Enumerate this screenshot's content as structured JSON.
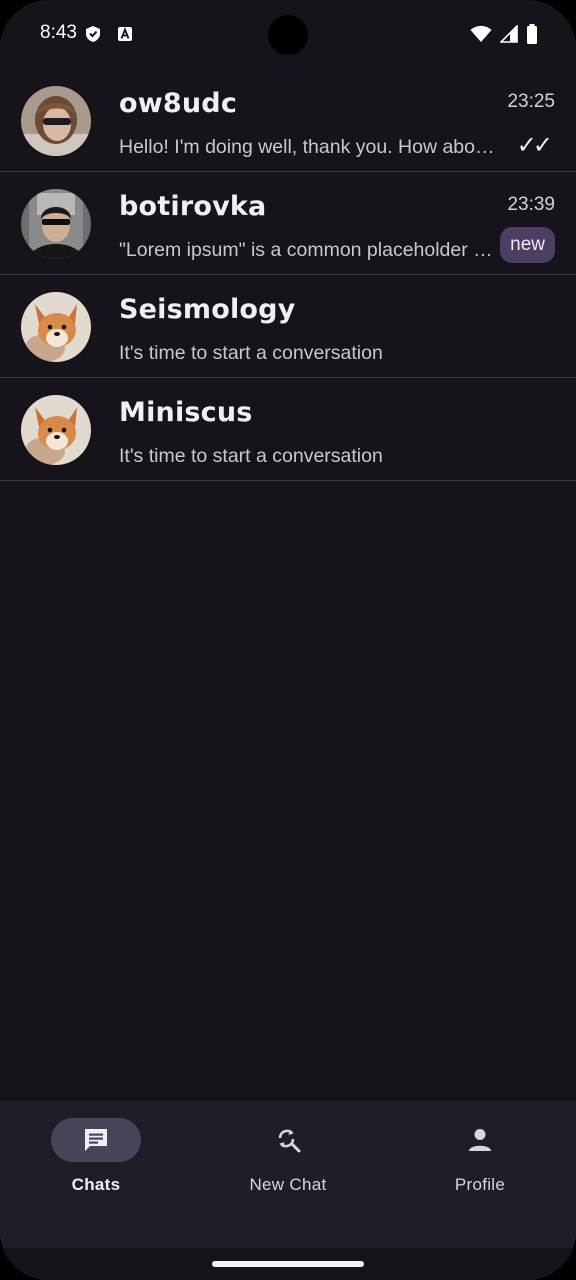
{
  "status_bar": {
    "time": "8:43",
    "icons": [
      "shield-icon",
      "a-icon"
    ],
    "right_icons": [
      "wifi-icon",
      "signal-icon",
      "battery-icon"
    ]
  },
  "chats": [
    {
      "name": "ow8udc",
      "time": "23:25",
      "preview": "Hello! I'm doing well, thank you. How about you?",
      "status": "read",
      "read_mark": "✓✓",
      "badge": "",
      "avatar": "person-photo"
    },
    {
      "name": "botirovka",
      "time": "23:39",
      "preview": "\"Lorem ipsum\" is a common placeholder text",
      "status": "new",
      "read_mark": "",
      "badge": "new",
      "avatar": "person-photo"
    },
    {
      "name": "Seismology",
      "time": "",
      "preview": "It's time to start a conversation",
      "status": "",
      "read_mark": "",
      "badge": "",
      "avatar": "corgi-photo"
    },
    {
      "name": "Miniscus",
      "time": "",
      "preview": "It's time to start a conversation",
      "status": "",
      "read_mark": "",
      "badge": "",
      "avatar": "corgi-photo"
    }
  ],
  "bottom_nav": {
    "items": [
      {
        "label": "Chats",
        "icon": "chat-icon",
        "active": true
      },
      {
        "label": "New Chat",
        "icon": "search-refresh-icon",
        "active": false
      },
      {
        "label": "Profile",
        "icon": "person-icon",
        "active": false
      }
    ]
  },
  "colors": {
    "background": "#16131a",
    "nav_background": "#211d26",
    "active_pill": "#4b4458",
    "badge": "#4d3f63",
    "divider": "#3a3640"
  }
}
